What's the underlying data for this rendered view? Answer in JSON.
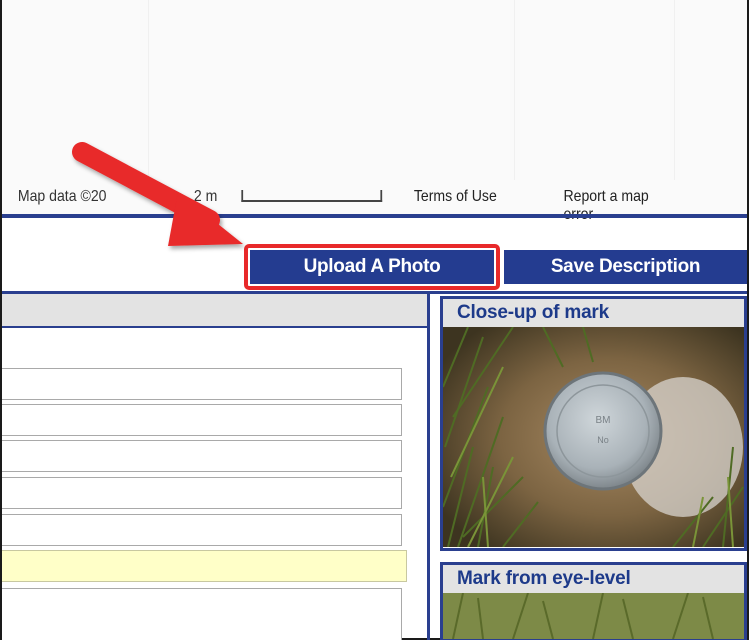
{
  "map": {
    "attribution": "Map data ©20",
    "scale_label": "2 m",
    "terms_link": "Terms of Use",
    "report_link": "Report a map error"
  },
  "toolbar": {
    "upload_label": "Upload A Photo",
    "save_label": "Save Description"
  },
  "photos": {
    "items": [
      {
        "title": "Close-up of mark",
        "disk_text_1": "BM",
        "disk_text_2": "No"
      },
      {
        "title": "Mark from eye-level"
      }
    ]
  },
  "colors": {
    "button_blue": "#243c90",
    "border_blue": "#2a3f8f",
    "highlight_red": "#e8292a",
    "yellow_field": "#ffffc8"
  }
}
